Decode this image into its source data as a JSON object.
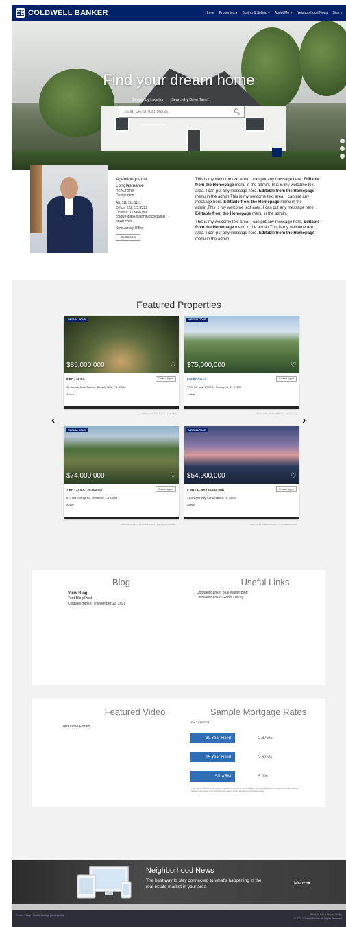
{
  "header": {
    "brand": "COLDWELL BANKER",
    "logo_letter": "CB",
    "nav": [
      "Home",
      "Properties ▾",
      "Buying & Selling ▾",
      "About Me ▾",
      "Neighborhood News",
      "Sign In"
    ]
  },
  "hero": {
    "title": "Find your dream home",
    "tabs": [
      "Search by Location",
      "Search by Drive Time*"
    ],
    "search_placeholder": "Tustin, CA, United States",
    "advanced": "SEARCH NEAR ME"
  },
  "agent": {
    "first_name": "Agentlongname",
    "last_name": "Longlastname",
    "title": "REALTOR®",
    "designation": "Designation",
    "lines": [
      "Alt: 111.111.1111",
      "Office: 222.222.2222",
      "License: 123456789",
      "coldwellbankeradmin@coldwellb",
      "anker.com",
      "New Jersey Office"
    ],
    "contact_label": "Contact Us"
  },
  "welcome": {
    "p1a": "This is my welcome text area. I can put any message here. ",
    "p1b": "Editable from the Homepage",
    "p1c": " menu in the admin. This is my welcome text area. I can put any message here. ",
    "p1d": "Editable from the Homepage",
    "p1e": " menu in the admin.This is my welcome text area. I can put any message here. ",
    "p1f": "Editable from the Homepage",
    "p1g": " menu in the admin.This is my welcome text area. I can put any message here. ",
    "p1h": "Editable from the Homepage",
    "p1i": " menu in the admin.",
    "p2a": "This is my welcome text area. I can put any message here. ",
    "p2b": "Editable from the Homepage",
    "p2c": " menu in the admin.This is my welcome text area. I can put any message here. ",
    "p2d": "Editable from the Homepage",
    "p2e": " menu in the admin."
  },
  "featured": {
    "title": "Featured Properties",
    "virtual_tour": "VIRTUAL TOUR",
    "contact_agent": "Contact Agent",
    "cards": [
      {
        "price": "$85,000,000",
        "specs": "8 BR | 12 BA",
        "address": "30 Beverly Park Terrace, Beverly Hills, CA 90210",
        "status": "Active",
        "credit": "CRMLS | Coldwell Banker | Jade Mills"
      },
      {
        "price": "$75,000,000",
        "specs": "243.87 Acres",
        "address": "2200 US Hwy 17/92 N, Davenport, FL 33837",
        "status": "Active",
        "credit": "Stellar MLS | Coldwell Banker | Commercial"
      },
      {
        "price": "$74,000,000",
        "specs": "7 BR | 17 BA | 20,000 Sqft",
        "address": "670 Hot Springs Rd, Montecito, CA 93108",
        "status": "Active",
        "credit": "Santa Barbara MLS | Coldwell Banker | Calcagno & Hamilton"
      },
      {
        "price": "$54,900,000",
        "specs": "8 BR | 11 BA | 23,282 Sqft",
        "address": "41 Arvida Pkwy, Coral Gables, FL 33156",
        "status": "Active",
        "credit": "Miami MLS | Coldwell Banker | Coral Gables Realty"
      }
    ]
  },
  "blog": {
    "title": "Blog",
    "view": "View Blog",
    "post_title": "Test Blog Post",
    "post_meta": "Coldwell Banker | November 12, 2021"
  },
  "links": {
    "title": "Useful Links",
    "items": [
      "Coldwell Banker Blue Matter Blog",
      "Coldwell Banker Global Luxury"
    ]
  },
  "video": {
    "title": "Featured Video",
    "text": "Test Video Embed"
  },
  "rates": {
    "title": "Sample Mortgage Rates",
    "date": "For 11/16/2021",
    "rows": [
      {
        "label": "30 Year Fixed",
        "value": "2.375%"
      },
      {
        "label": "15 Year Fixed",
        "value": "2.625%"
      },
      {
        "label": "5/1 ARM",
        "value": "5.0%"
      }
    ],
    "disclaimer": "These sample rates are for informational purposes only and do not constitute a loan offer. Rates are subject to change without notice and vary based on loan amount, credit profile and other factors. Contact a lender for a personalized quote."
  },
  "news": {
    "title": "Neighborhood News",
    "text": "The best way to stay connected to what's happening in the real estate market in your area",
    "more": "More ➔"
  },
  "footer": {
    "left": "Privacy Policy | Cookie Settings | Accessibility",
    "right1": "Terms of Use & Privacy Policy",
    "right2": "© 2021 Coldwell Banker. All Rights Reserved"
  },
  "colors": {
    "brand_navy": "#012169",
    "rate_blue": "#2f6db5"
  }
}
